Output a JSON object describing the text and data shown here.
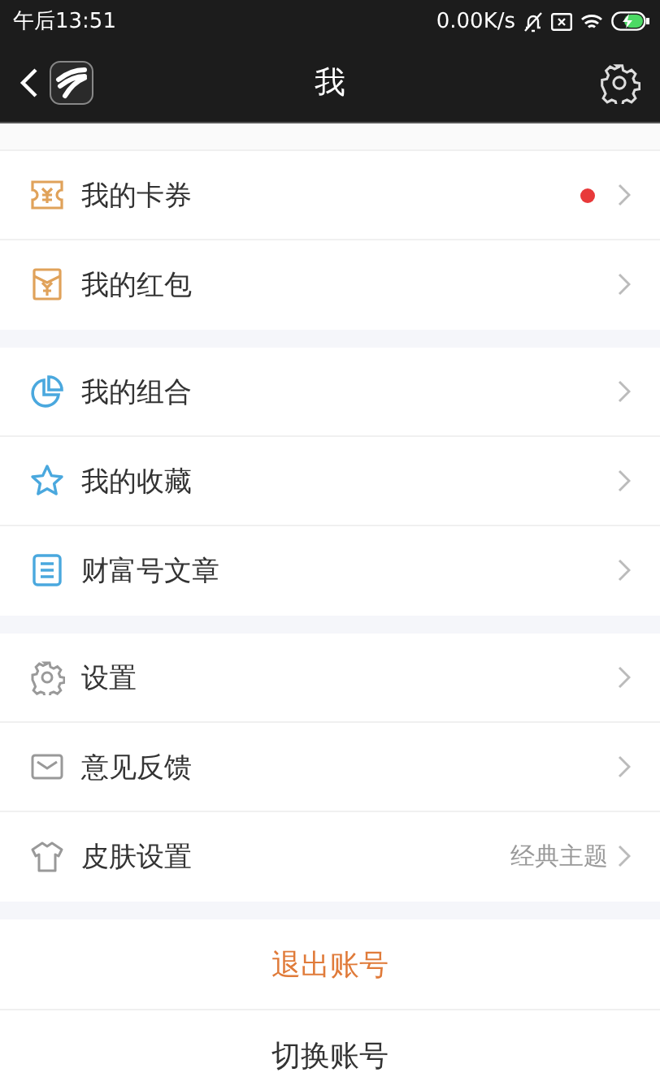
{
  "status_bar": {
    "time": "午后13:51",
    "speed": "0.00K/s"
  },
  "nav_bar": {
    "title": "我"
  },
  "sections": [
    {
      "items": [
        {
          "label": "我的卡券",
          "dot": true,
          "color": "#e8393a"
        },
        {
          "label": "我的红包",
          "dot": false
        }
      ]
    },
    {
      "items": [
        {
          "label": "我的组合",
          "dot": false
        },
        {
          "label": "我的收藏",
          "dot": false
        },
        {
          "label": "财富号文章",
          "dot": false
        }
      ]
    },
    {
      "items": [
        {
          "label": "设置",
          "dot": false
        },
        {
          "label": "意见反馈",
          "dot": false
        },
        {
          "label": "皮肤设置",
          "dot": false,
          "value": "经典主题"
        }
      ]
    }
  ],
  "actions": [
    {
      "label": "退出账号",
      "kind": "danger"
    },
    {
      "label": "切换账号",
      "kind": "normal"
    }
  ]
}
